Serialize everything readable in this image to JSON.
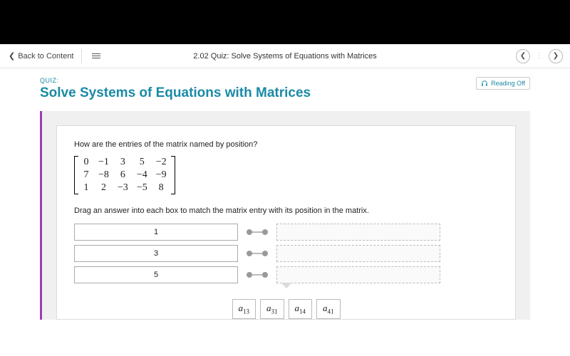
{
  "nav": {
    "back": "Back to Content",
    "title": "2.02 Quiz: Solve Systems of Equations with Matrices"
  },
  "header": {
    "kicker": "QUIZ:",
    "title": "Solve Systems of Equations with Matrices",
    "reading": "Reading Off"
  },
  "quiz": {
    "question": "How are the entries of the matrix named by position?",
    "instruction": "Drag an answer into each box to match the matrix entry with its position in the matrix.",
    "matrix": [
      [
        "0",
        "−1",
        "3",
        "5",
        "−2"
      ],
      [
        "7",
        "−8",
        "6",
        "−4",
        "−9"
      ],
      [
        "1",
        "2",
        "−3",
        "−5",
        "8"
      ]
    ],
    "rows": [
      {
        "given": "1"
      },
      {
        "given": "3"
      },
      {
        "given": "5"
      }
    ],
    "tiles": [
      {
        "base": "a",
        "sub": "13"
      },
      {
        "base": "a",
        "sub": "31"
      },
      {
        "base": "a",
        "sub": "14"
      },
      {
        "base": "a",
        "sub": "41"
      }
    ]
  }
}
